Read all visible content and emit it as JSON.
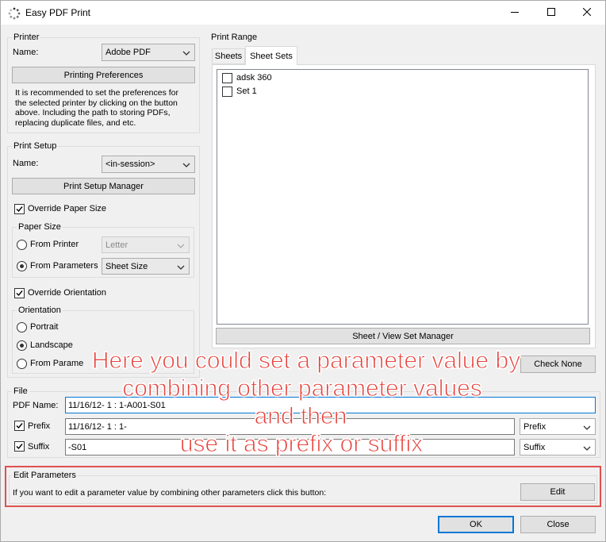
{
  "window": {
    "title": "Easy PDF Print"
  },
  "printer": {
    "group_label": "Printer",
    "name_label": "Name:",
    "name_value": "Adobe PDF",
    "prefs_button": "Printing Preferences",
    "note_lines": [
      "It is recommended to set the preferences for",
      "the selected printer by clicking on the button",
      "above. Including the path to storing PDFs,",
      "replacing duplicate files, and etc."
    ]
  },
  "print_setup": {
    "group_label": "Print Setup",
    "name_label": "Name:",
    "name_value": "<in-session>",
    "manager_button": "Print Setup Manager",
    "override_paper_label": "Override Paper Size",
    "override_paper_checked": true,
    "paper_size": {
      "group_label": "Paper Size",
      "from_printer_label": "From Printer",
      "from_printer_value": "Letter",
      "from_parameters_label": "From Parameters",
      "from_parameters_value": "Sheet Size",
      "selected": "from_parameters"
    },
    "override_orientation_label": "Override Orientation",
    "override_orientation_checked": true,
    "orientation": {
      "group_label": "Orientation",
      "portrait_label": "Portrait",
      "landscape_label": "Landscape",
      "from_params_label_visible": "From Parame",
      "selected": "landscape"
    }
  },
  "print_range": {
    "group_label": "Print Range",
    "tabs": [
      "Sheets",
      "Sheet Sets"
    ],
    "active_tab": "Sheet Sets",
    "items": [
      {
        "label": "adsk 360",
        "checked": false
      },
      {
        "label": "Set 1",
        "checked": false
      }
    ],
    "manager_button": "Sheet / View Set Manager",
    "check_none_button": "Check None"
  },
  "file": {
    "group_label": "File",
    "pdf_name_label": "PDF Name:",
    "pdf_name_value": "11/16/12- 1 : 1-A001-S01",
    "prefix_label": "Prefix",
    "prefix_checked": true,
    "prefix_value": "11/16/12- 1 : 1-",
    "prefix_combo": "Prefix",
    "suffix_label": "Suffix",
    "suffix_checked": true,
    "suffix_value": "-S01",
    "suffix_combo": "Suffix"
  },
  "edit_parameters": {
    "group_label": "Edit Parameters",
    "description": "If you want to edit a parameter value by combining other parameters click this button:",
    "edit_button": "Edit"
  },
  "footer": {
    "ok_button": "OK",
    "close_button": "Close"
  },
  "annotation": {
    "lines": [
      "Here you could set a parameter value by",
      "combining other parameter values",
      "and then",
      "use it as prefix or suffix"
    ],
    "color": "#e8433d"
  },
  "colors": {
    "accent": "#0078d7",
    "highlight_box": "#e05050"
  }
}
